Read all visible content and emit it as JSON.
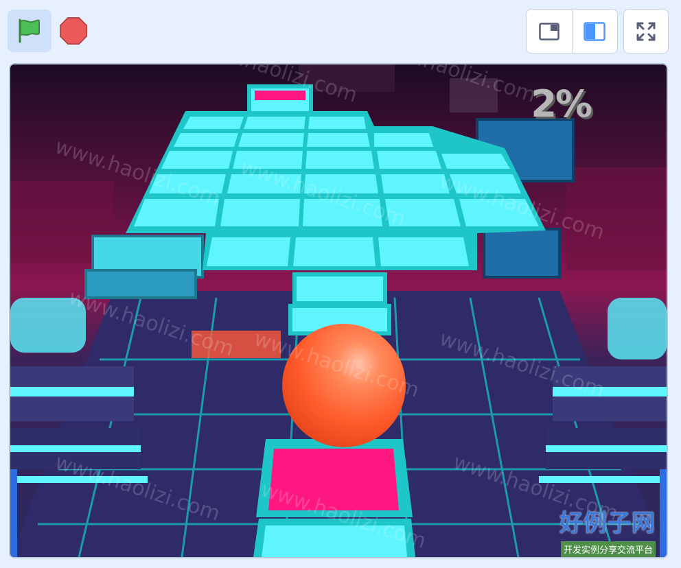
{
  "toolbar": {
    "green_flag_icon": "green-flag-icon",
    "stop_icon": "stop-sign-icon",
    "small_stage_icon": "small-stage-icon",
    "normal_stage_icon": "normal-stage-icon",
    "fullscreen_icon": "fullscreen-icon"
  },
  "colors": {
    "flag": "#4cbf56",
    "stop": "#ec5959",
    "accent": "#4c97ff",
    "tile": "#5ff5ff",
    "tile_border": "#1ec6c8",
    "pink_tile": "#ff1781",
    "ball": "#ff5a2a",
    "sky_top": "#1c0b25",
    "sky_mid": "#8b1650"
  },
  "game": {
    "progress": "2%",
    "watermark_url": "www.haolizi.com",
    "brand": "好例子网",
    "brand_sub": "开发实例分享交流平台"
  }
}
